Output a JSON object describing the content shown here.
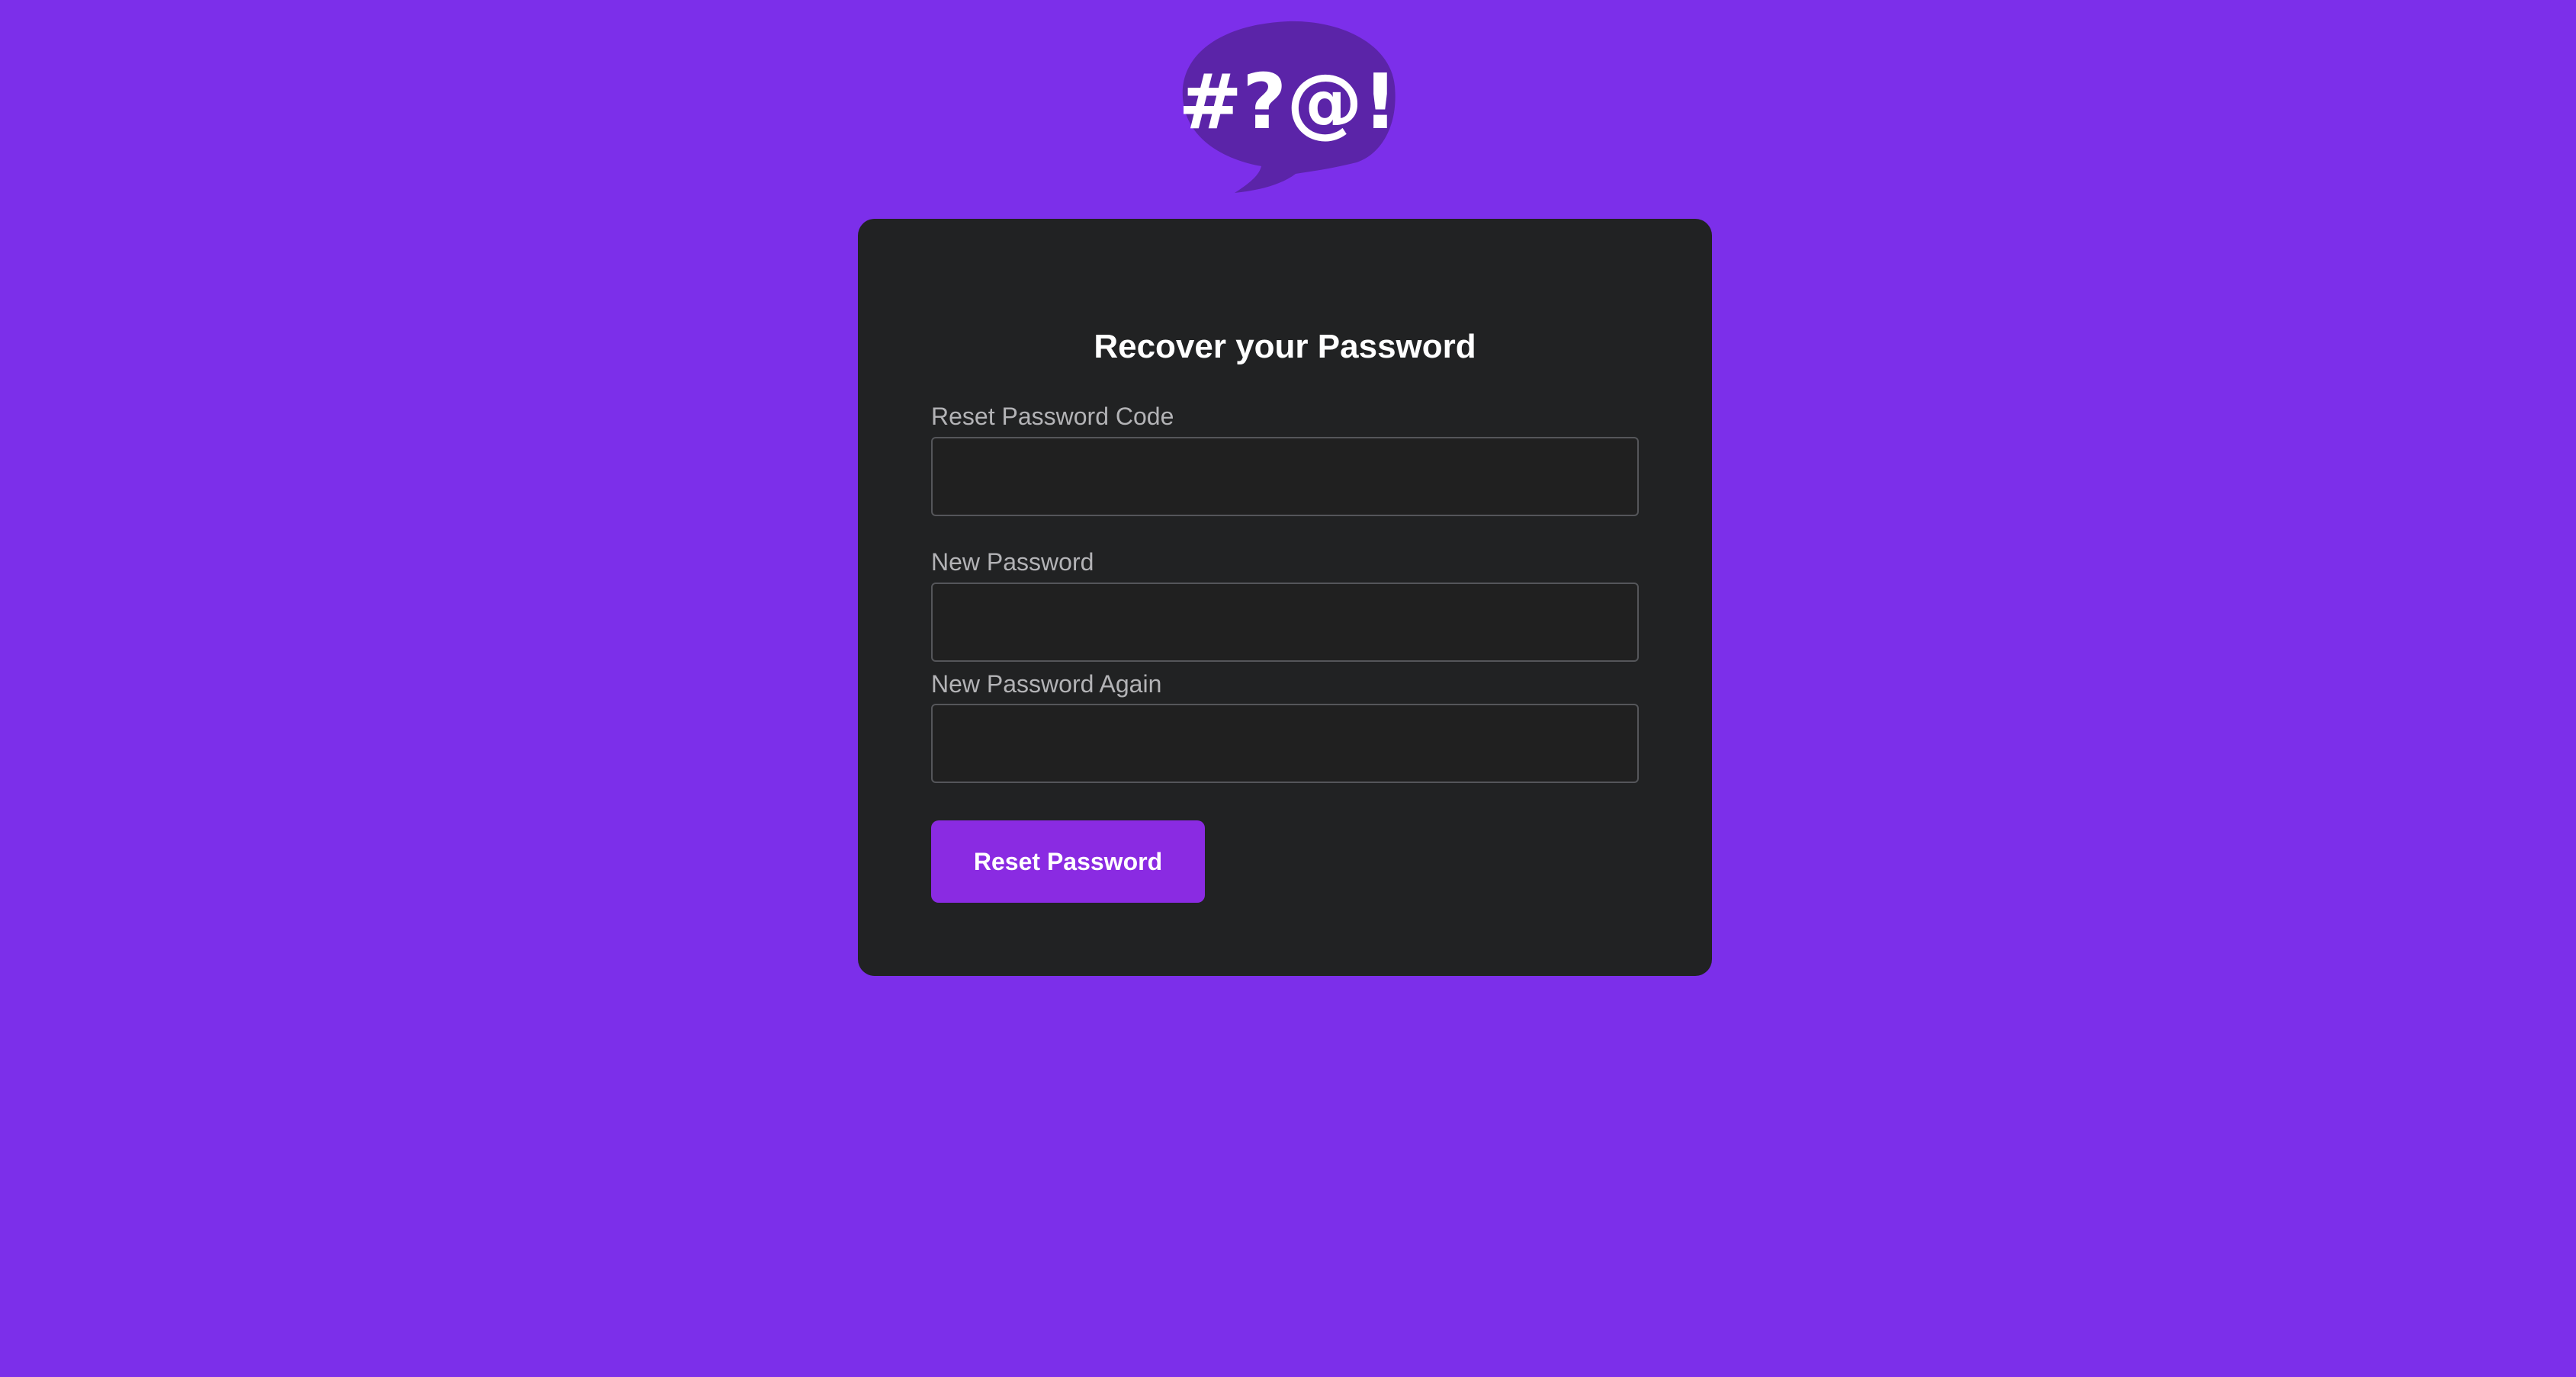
{
  "logo": {
    "glyphs": "#?@!",
    "icon": "speech-bubble-logo-icon",
    "bubble_color": "#5b24a8",
    "glyph_color": "#ffffff"
  },
  "colors": {
    "background": "#7c2fea",
    "card": "#212223",
    "accent": "#8a2be2"
  },
  "form": {
    "title": "Recover your Password",
    "fields": [
      {
        "label": "Reset Password Code",
        "value": "",
        "placeholder": ""
      },
      {
        "label": "New Password",
        "value": "",
        "placeholder": ""
      },
      {
        "label": "New Password Again",
        "value": "",
        "placeholder": ""
      }
    ],
    "submit_label": "Reset Password"
  }
}
